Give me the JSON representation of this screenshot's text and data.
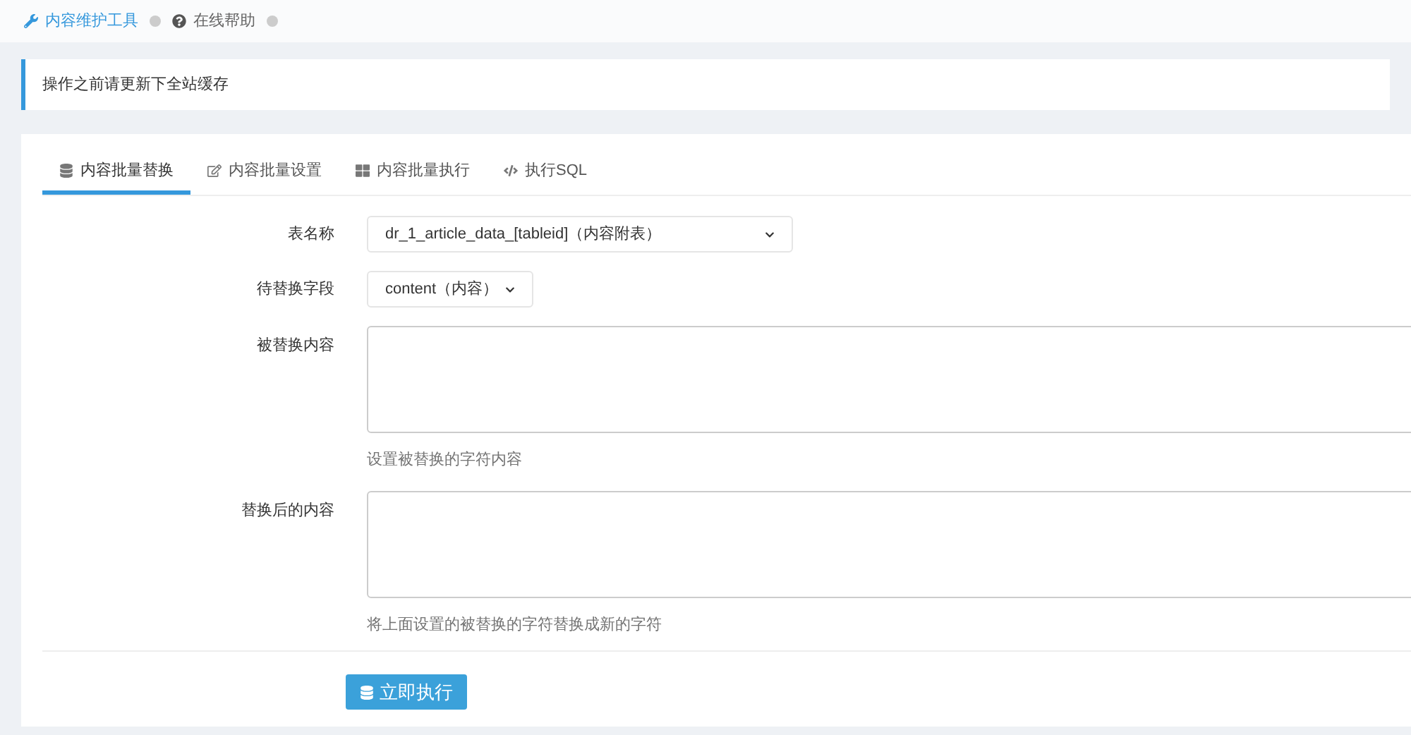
{
  "breadcrumb": [
    {
      "label": "内容维护工具",
      "selected": true
    },
    {
      "label": "在线帮助",
      "selected": false
    }
  ],
  "alert": "操作之前请更新下全站缓存",
  "tabs": [
    {
      "label": "内容批量替换",
      "selected": true
    },
    {
      "label": "内容批量设置",
      "selected": false
    },
    {
      "label": "内容批量执行",
      "selected": false
    },
    {
      "label": "执行SQL",
      "selected": false
    }
  ],
  "form": [
    {
      "kind": "select",
      "label": "表名称",
      "value": "dr_1_article_data_[tableid]（内容附表）"
    },
    {
      "kind": "select",
      "label": "待替换字段",
      "value": "content（内容）"
    },
    {
      "kind": "textarea",
      "label": "被替换内容",
      "help": "设置被替换的字符内容"
    },
    {
      "kind": "textarea",
      "label": "替换后的内容",
      "help": "将上面设置的被替换的字符替换成新的字符"
    }
  ],
  "submit": {
    "label": "立即执行"
  }
}
